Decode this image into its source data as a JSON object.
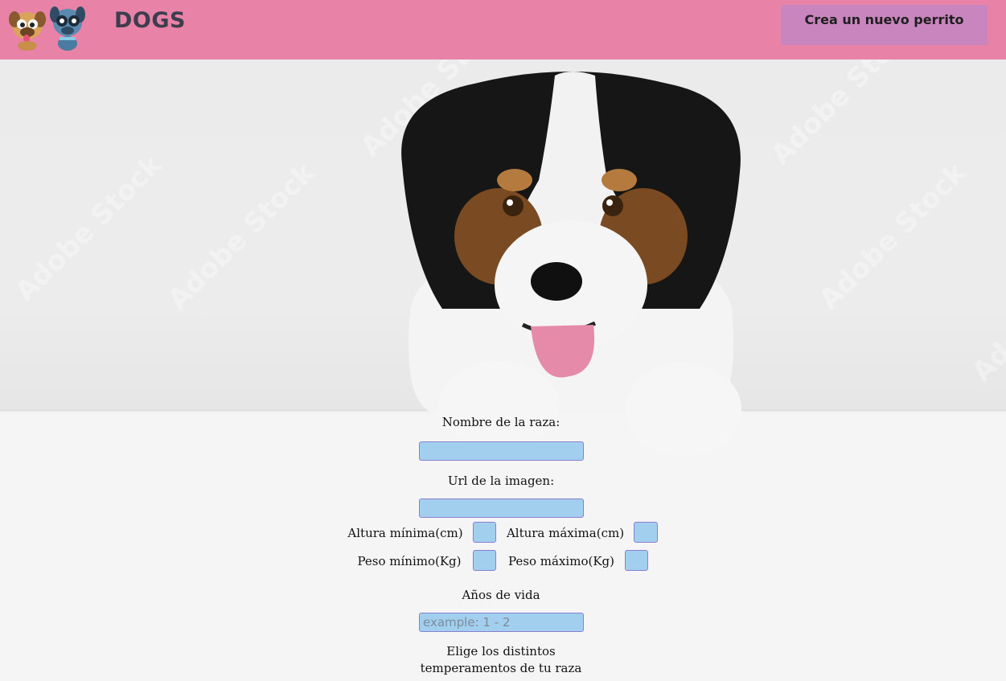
{
  "navbar": {
    "brand": "DOGS",
    "create_button": "Crea un nuevo perrito"
  },
  "form": {
    "name_label": "Nombre de la raza:",
    "image_label": "Url de la imagen:",
    "height_min_label": "Altura mínima(cm)",
    "height_max_label": "Altura máxima(cm)",
    "weight_min_label": "Peso mínimo(Kg)",
    "weight_max_label": "Peso máximo(Kg)",
    "life_span_label": "Años de vida",
    "life_span_placeholder": "example: 1 - 2",
    "temperaments_line1": "Elige los distintos",
    "temperaments_line2": "temperamentos de tu raza"
  },
  "watermark": "Adobe Stock",
  "colors": {
    "navbar": "#e882a6",
    "button": "#c985bd",
    "input": "#a3cfee"
  }
}
